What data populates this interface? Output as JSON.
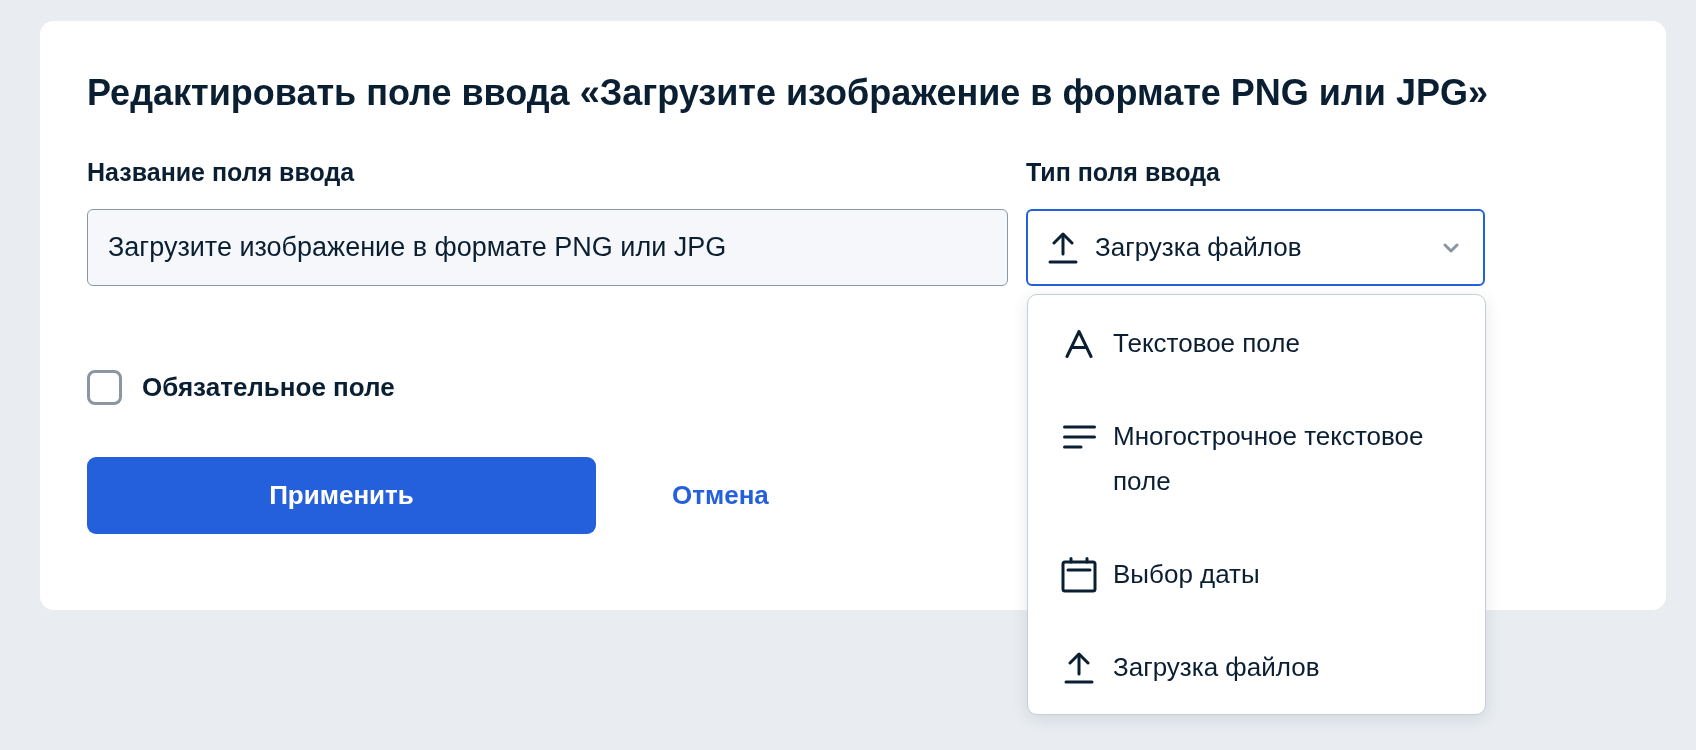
{
  "title": "Редактировать поле ввода «Загрузите изображение в формате PNG или JPG»",
  "name_field": {
    "label": "Название поля ввода",
    "value": "Загрузите изображение в формате PNG или JPG"
  },
  "type_field": {
    "label": "Тип поля ввода",
    "value": "Загрузка файлов",
    "kind": "upload",
    "expanded": true,
    "options": [
      {
        "label": "Текстовое поле",
        "kind": "text"
      },
      {
        "label": "Многострочное текстовое поле",
        "kind": "multiline"
      },
      {
        "label": "Выбор даты",
        "kind": "date"
      },
      {
        "label": "Загрузка файлов",
        "kind": "upload"
      }
    ]
  },
  "required": {
    "label": "Обязательное поле",
    "checked": false
  },
  "buttons": [
    {
      "label": "Применить",
      "kind": "primary"
    },
    {
      "label": "Отмена",
      "kind": "link"
    }
  ]
}
